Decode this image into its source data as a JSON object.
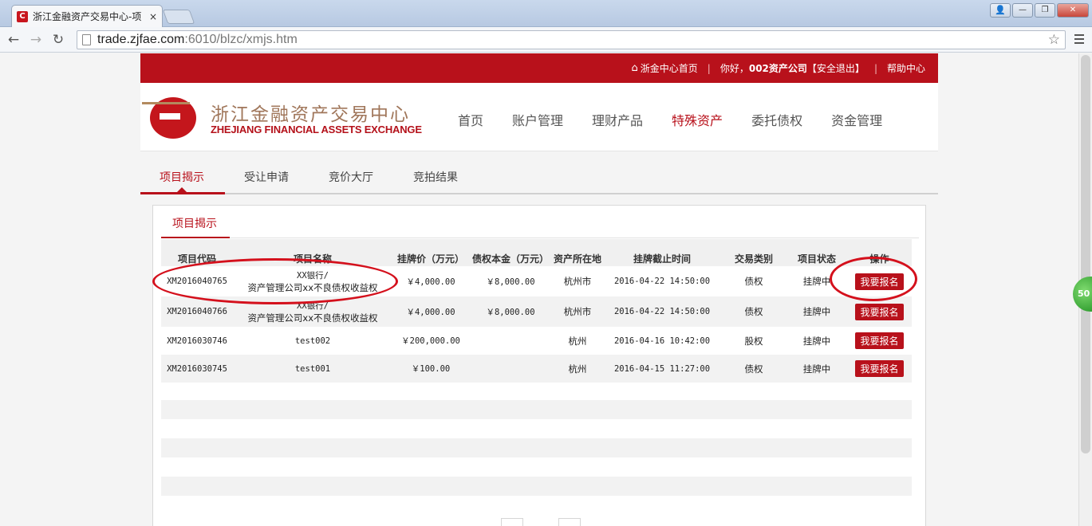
{
  "browser": {
    "tab_title": "浙江金融资产交易中心-项",
    "tab_close": "×",
    "favicon_letter": "C",
    "url_host": "trade.zjfae.com",
    "url_path": ":6010/blzc/xmjs.htm",
    "back_icon": "←",
    "forward_icon": "→",
    "reload_icon": "↻",
    "star_icon": "☆",
    "win_minimize": "—",
    "win_restore": "❐",
    "win_close": "✕",
    "win_user": "👤"
  },
  "topbar": {
    "home_label": "浙金中心首页",
    "greeting_prefix": "你好，",
    "company": "002资产公司",
    "logout": "【安全退出】",
    "help": "帮助中心",
    "sep": "|"
  },
  "logo": {
    "cn": "浙江金融资产交易中心",
    "en": "ZHEJIANG FINANCIAL ASSETS EXCHANGE"
  },
  "mainnav": [
    "首页",
    "账户管理",
    "理财产品",
    "特殊资产",
    "委托债权",
    "资金管理"
  ],
  "subtabs": [
    "项目揭示",
    "受让申请",
    "竞价大厅",
    "竞拍结果"
  ],
  "panel": {
    "tab": "项目揭示",
    "columns": [
      "项目代码",
      "项目名称",
      "挂牌价（万元）",
      "债权本金（万元）",
      "资产所在地",
      "挂牌截止时间",
      "交易类别",
      "项目状态",
      "操作"
    ],
    "rows": [
      {
        "code": "XM2016040765",
        "name1": "XX银行/",
        "name2": "资产管理公司xx不良债权收益权",
        "price": "￥4,000.00",
        "principal": "￥8,000.00",
        "location": "杭州市",
        "deadline": "2016-04-22 14:50:00",
        "category": "债权",
        "status": "挂牌中",
        "action": "我要报名"
      },
      {
        "code": "XM2016040766",
        "name1": "XX银行/",
        "name2": "资产管理公司xx不良债权收益权",
        "price": "￥4,000.00",
        "principal": "￥8,000.00",
        "location": "杭州市",
        "deadline": "2016-04-22 14:50:00",
        "category": "债权",
        "status": "挂牌中",
        "action": "我要报名"
      },
      {
        "code": "XM2016030746",
        "name1": "test002",
        "name2": "",
        "price": "￥200,000.00",
        "principal": "",
        "location": "杭州",
        "deadline": "2016-04-16 10:42:00",
        "category": "股权",
        "status": "挂牌中",
        "action": "我要报名"
      },
      {
        "code": "XM2016030745",
        "name1": "test001",
        "name2": "",
        "price": "￥100.00",
        "principal": "",
        "location": "杭州",
        "deadline": "2016-04-15 11:27:00",
        "category": "债权",
        "status": "挂牌中",
        "action": "我要报名"
      }
    ]
  },
  "float_badge": "50",
  "colors": {
    "brand_red": "#b8111b",
    "annotation_red": "#d4101c"
  }
}
